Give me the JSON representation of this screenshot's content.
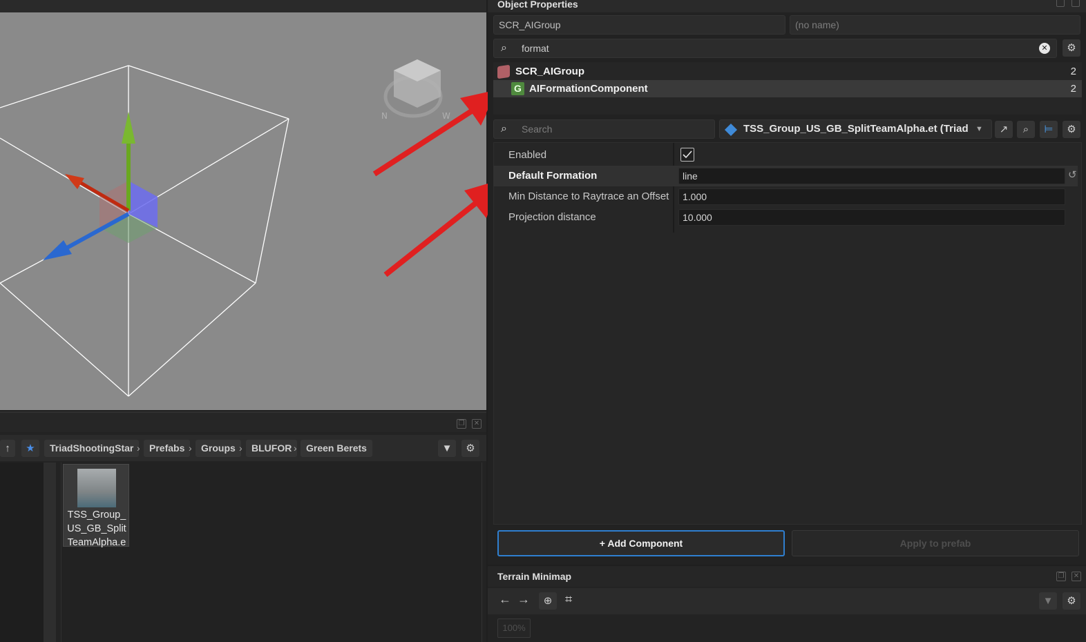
{
  "viewport": {},
  "object_properties": {
    "title": "Object Properties",
    "class_field": "SCR_AIGroup",
    "name_placeholder": "(no name)",
    "filter_value": "format",
    "tree": [
      {
        "label": "SCR_AIGroup",
        "count": "2"
      },
      {
        "label": "AIFormationComponent",
        "count": "2"
      }
    ],
    "search_placeholder": "Search",
    "prefab_selector": "TSS_Group_US_GB_SplitTeamAlpha.et (Triad",
    "properties": [
      {
        "label": "Enabled",
        "checked": true
      },
      {
        "label": "Default Formation",
        "value": "line"
      },
      {
        "label": "Min Distance to Raytrace an Offset",
        "value": "1.000"
      },
      {
        "label": "Projection distance",
        "value": "10.000"
      }
    ],
    "add_component_label": "+ Add Component",
    "apply_prefab_label": "Apply to prefab"
  },
  "asset_browser": {
    "breadcrumbs": [
      "TriadShootingStar",
      "Prefabs",
      "Groups",
      "BLUFOR",
      "Green Berets"
    ],
    "assets": [
      {
        "name": "TSS_Group_US_GB_SplitTeamAlpha.e",
        "display": "TSS_Group_\nUS_GB_Split\nTeamAlpha.e"
      }
    ]
  },
  "terrain_minimap": {
    "title": "Terrain Minimap",
    "zoom": "100%"
  },
  "colors": {
    "accent_blue": "#2f7fd0",
    "annotation_red": "#e02020",
    "selected_row": "#3a3a3a"
  }
}
